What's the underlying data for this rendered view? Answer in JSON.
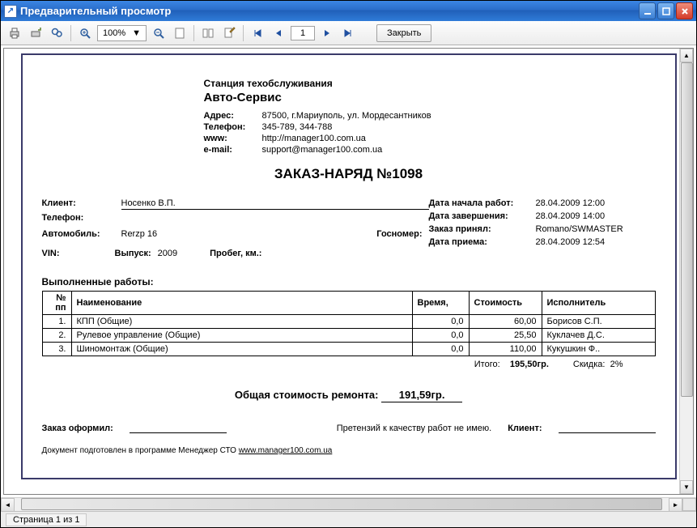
{
  "window": {
    "title": "Предварительный просмотр",
    "close_button": "Закрыть"
  },
  "toolbar": {
    "zoom": "100%",
    "page": "1"
  },
  "status": {
    "page_of": "Страница 1 из 1"
  },
  "doc": {
    "station_label": "Станция техобслуживания",
    "company": "Авто-Сервис",
    "contacts": {
      "address_label": "Адрес:",
      "address": "87500, г.Мариуполь, ул. Мордесантников",
      "phone_label": "Телефон:",
      "phone": "345-789, 344-788",
      "www_label": "www:",
      "www": "http://manager100.com.ua",
      "email_label": "e-mail:",
      "email": "support@manager100.com.ua"
    },
    "title": "ЗАКАЗ-НАРЯД №1098",
    "meta_left": {
      "client_label": "Клиент:",
      "client": "Носенко В.П.",
      "phone_label": "Телефон:",
      "phone": "",
      "car_label": "Автомобиль:",
      "car": "Rerzp 16",
      "gos_label": "Госномер:",
      "gos": "",
      "vin_label": "VIN:",
      "vin": "",
      "year_label": "Выпуск:",
      "year": "2009",
      "mileage_label": "Пробег, км.:",
      "mileage": ""
    },
    "meta_right": {
      "start_label": "Дата начала работ:",
      "start": "28.04.2009 12:00",
      "end_label": "Дата завершения:",
      "end": "28.04.2009 14:00",
      "accept_label": "Заказ принял:",
      "accept": "Romano/SWMASTER",
      "recv_label": "Дата приема:",
      "recv": "28.04.2009 12:54"
    },
    "works_section": "Выполненные работы:",
    "works_headers": {
      "num": "№ пп",
      "name": "Наименование",
      "time": "Время,",
      "cost": "Стоимость",
      "exec": "Исполнитель"
    },
    "works": [
      {
        "n": "1.",
        "name": "КПП (Общие)",
        "time": "0,0",
        "cost": "60,00",
        "exec": "Борисов С.П."
      },
      {
        "n": "2.",
        "name": "Рулевое управление (Общие)",
        "time": "0,0",
        "cost": "25,50",
        "exec": "Куклачев Д.С."
      },
      {
        "n": "3.",
        "name": "Шиномонтаж (Общие)",
        "time": "0,0",
        "cost": "110,00",
        "exec": "Кукушкин Ф.."
      }
    ],
    "totals": {
      "itogo_label": "Итого:",
      "itogo": "195,50гр.",
      "discount_label": "Скидка:",
      "discount": "2%"
    },
    "grand": {
      "label": "Общая стоимость ремонта:",
      "value": "191,59гр."
    },
    "sign": {
      "issued_label": "Заказ оформил:",
      "claims_label": "Претензий к качеству работ не имею.",
      "client_label": "Клиент:"
    },
    "footnote": {
      "text": "Документ подготовлен в программе Менеджер СТО ",
      "link": "www.manager100.com.ua"
    }
  }
}
